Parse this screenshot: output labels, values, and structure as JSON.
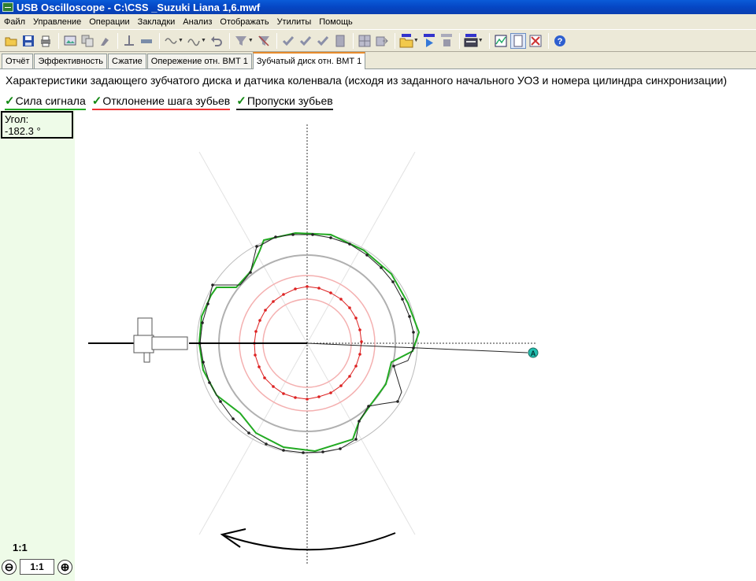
{
  "window": {
    "title": "USB Oscilloscope - C:\\CSS _Suzuki Liana 1,6.mwf"
  },
  "menu": [
    "Файл",
    "Управление",
    "Операции",
    "Закладки",
    "Анализ",
    "Отображать",
    "Утилиты",
    "Помощь"
  ],
  "tabs": [
    {
      "label": "Отчёт",
      "active": false
    },
    {
      "label": "Эффективность",
      "active": false
    },
    {
      "label": "Сжатие",
      "active": false
    },
    {
      "label": "Опережение отн. ВМТ 1",
      "active": false
    },
    {
      "label": "Зубчатый диск отн. ВМТ 1",
      "active": true
    }
  ],
  "content": {
    "heading": "Характеристики задающего зубчатого диска и датчика коленвала (исходя из заданного начального УОЗ и номера цилиндра синхронизации)",
    "legend": [
      {
        "label": "Сила сигнала",
        "checked": true,
        "color": "#22aa22"
      },
      {
        "label": "Отклонение шага зубьев",
        "checked": true,
        "color": "#ee3333"
      },
      {
        "label": "Пропуски зубьев",
        "checked": true,
        "color": "#222222"
      }
    ],
    "marker": "A"
  },
  "side": {
    "angle_label": "Угол:",
    "angle_value": "-182.3 °",
    "scale_label": "1:1",
    "zoom_value": "1:1",
    "zoom_out_symbol": "⊖",
    "zoom_in_symbol": "⊕"
  },
  "colors": {
    "signal": "#22aa22",
    "deviation": "#ee3333",
    "gaps": "#222222",
    "marker": "#22c0b0"
  }
}
